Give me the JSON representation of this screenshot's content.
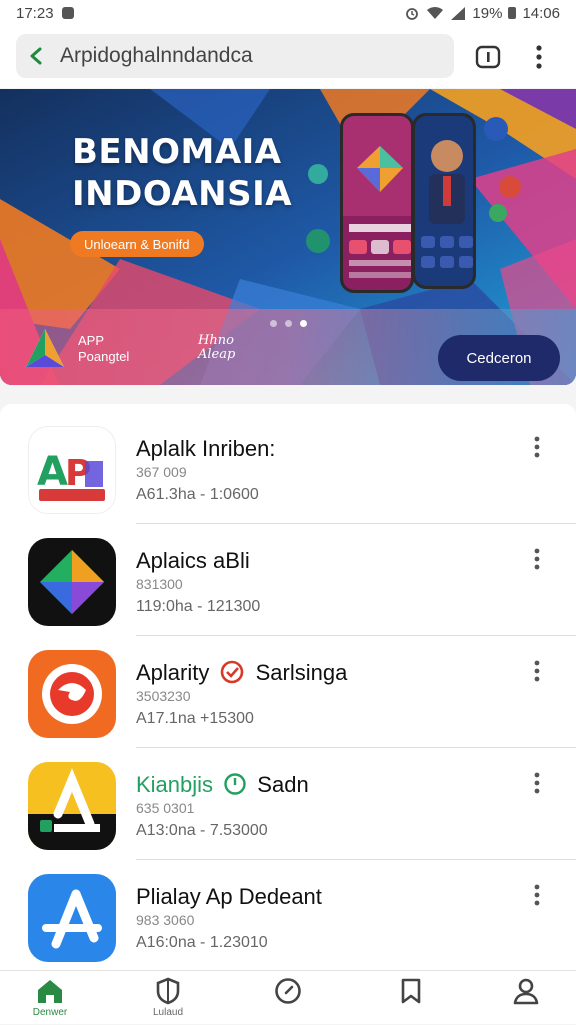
{
  "status_bar": {
    "time": "17:23",
    "battery": "19%",
    "clock_right": "14:06"
  },
  "address_bar": {
    "url": "Arpidoghalnndandca",
    "accent_color": "#1f8a3e"
  },
  "banner": {
    "title_line1": "BENOMAIA",
    "title_line2": "INDOANSIA",
    "pill": "Unloearn & Bonifd",
    "logo_line1": "APP",
    "logo_line2": "Poangtel",
    "script_line1": "Hhno",
    "script_line2": "Aleap",
    "button": "Cedceron",
    "page_indicator": {
      "count": 3,
      "active": 3
    }
  },
  "apps": [
    {
      "name": "Aplalk Inriben:",
      "sub1": "367 009",
      "sub2": "A61.3ha - 1:0600",
      "icon": "apk-logo-icon"
    },
    {
      "name": "Aplaics aBli",
      "sub1": "831300",
      "sub2": "119:0ha - 121300",
      "icon": "diamond-logo-icon"
    },
    {
      "name": "Aplarity",
      "name_extra": "Sarlsinga",
      "sub1": "3503230",
      "sub2": "A17.1na +15300",
      "icon": "swirl-logo-icon"
    },
    {
      "name": "Kianbjis",
      "name_extra": "Sadn",
      "sub1": "635 0301",
      "sub2": "A13:0na - 7.53000",
      "icon": "lambda-logo-icon"
    },
    {
      "name": "Plialay Ap Dedeant",
      "sub1": "983 3060",
      "sub2": "A16:0na - 1.23010",
      "icon": "app-store-icon"
    }
  ],
  "bottom_nav": {
    "active_label": "Denwer",
    "second_label": "Lulaud",
    "active_color": "#2a8a44",
    "items": [
      "home-icon",
      "shield-icon",
      "compass-icon",
      "bookmark-icon",
      "profile-icon"
    ]
  }
}
